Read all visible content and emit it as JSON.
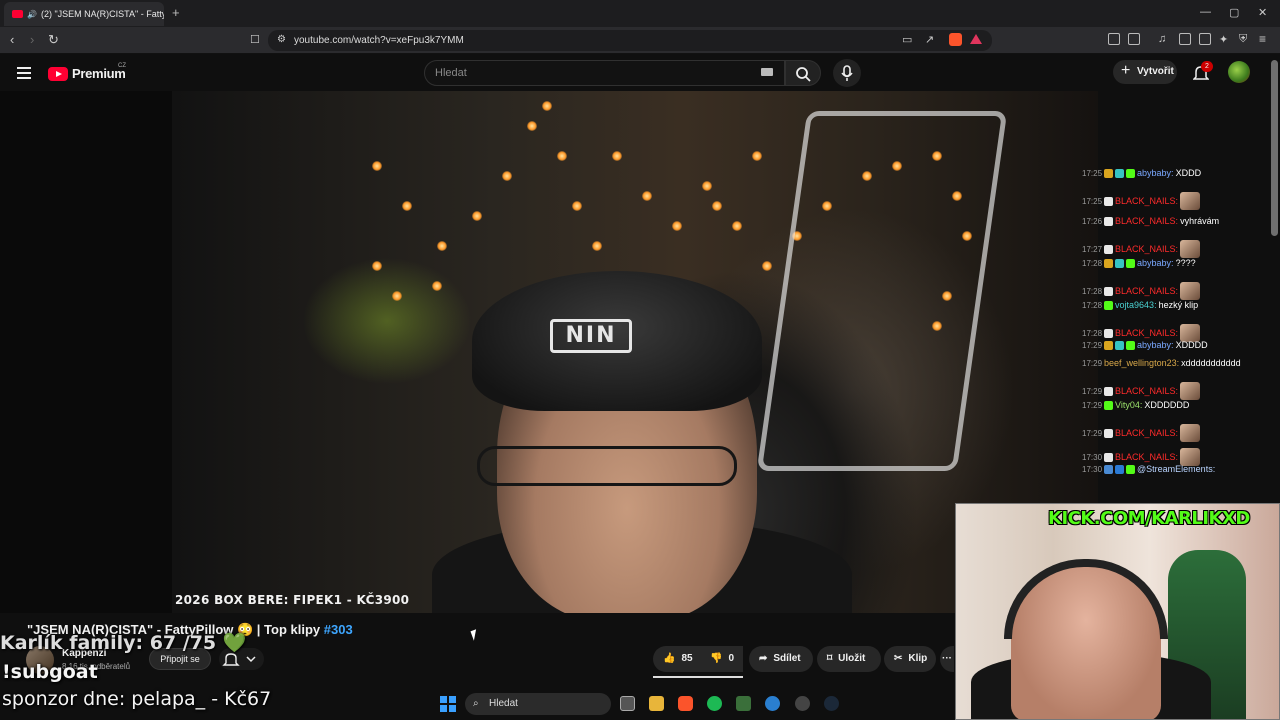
{
  "browser": {
    "tab_title": "(2) \"JSEM NA(R)CISTA\" - Fatty",
    "tab_close": "✕",
    "new_tab": "+",
    "url": "youtube.com/watch?v=xeFpu3k7YMM",
    "window_controls": [
      "—",
      "▢",
      "✕"
    ]
  },
  "youtube_header": {
    "logo_text": "Premium",
    "logo_region": "CZ",
    "search_placeholder": "Hledat",
    "create_label": "Vytvořit",
    "notification_count": "2"
  },
  "video": {
    "cap_logo": "NIN",
    "overlay_subtitle": "2026 BOX BERE: FIPEK1 - KČ3900",
    "kick_banner": "KICK.COM/KARLIKXD"
  },
  "chat": {
    "messages": [
      {
        "time": "17:25",
        "user": "abybaby:",
        "text": "XDDD",
        "color": "#7aa8ff",
        "badges": [
          "#d9a51f",
          "#37c3c3",
          "#53fc18"
        ],
        "emote": false
      },
      {
        "time": "17:25",
        "user": "BLACK_NAILS:",
        "text": "",
        "color": "#ff2b2b",
        "badges": [
          "#e8e8e8"
        ],
        "emote": true
      },
      {
        "time": "17:26",
        "user": "BLACK_NAILS:",
        "text": "vyhrávám",
        "color": "#ff2b2b",
        "badges": [
          "#e8e8e8"
        ],
        "emote": false
      },
      {
        "time": "17:27",
        "user": "BLACK_NAILS:",
        "text": "",
        "color": "#ff2b2b",
        "badges": [
          "#e8e8e8"
        ],
        "emote": true
      },
      {
        "time": "17:28",
        "user": "abybaby:",
        "text": "????",
        "color": "#7aa8ff",
        "badges": [
          "#d9a51f",
          "#37c3c3",
          "#53fc18"
        ],
        "emote": false
      },
      {
        "time": "17:28",
        "user": "BLACK_NAILS:",
        "text": "",
        "color": "#ff2b2b",
        "badges": [
          "#e8e8e8"
        ],
        "emote": true
      },
      {
        "time": "17:28",
        "user": "vojta9643:",
        "text": "hezký klip",
        "color": "#4ad0d0",
        "badges": [
          "#53fc18"
        ],
        "emote": false
      },
      {
        "time": "17:28",
        "user": "BLACK_NAILS:",
        "text": "",
        "color": "#ff2b2b",
        "badges": [
          "#e8e8e8"
        ],
        "emote": true
      },
      {
        "time": "17:29",
        "user": "abybaby:",
        "text": "XDDDD",
        "color": "#7aa8ff",
        "badges": [
          "#d9a51f",
          "#37c3c3",
          "#53fc18"
        ],
        "emote": false
      },
      {
        "time": "17:29",
        "user": "beef_wellington23:",
        "text": "xddddddddddd",
        "color": "#d8a84a",
        "badges": [],
        "emote": false
      },
      {
        "time": "17:29",
        "user": "BLACK_NAILS:",
        "text": "",
        "color": "#ff2b2b",
        "badges": [
          "#e8e8e8"
        ],
        "emote": true
      },
      {
        "time": "17:29",
        "user": "Vity04:",
        "text": "XDDDDDD",
        "color": "#9be36b",
        "badges": [
          "#53fc18"
        ],
        "emote": false
      },
      {
        "time": "17:29",
        "user": "BLACK_NAILS:",
        "text": "",
        "color": "#ff2b2b",
        "badges": [
          "#e8e8e8"
        ],
        "emote": true
      },
      {
        "time": "17:30",
        "user": "BLACK_NAILS:",
        "text": "",
        "color": "#ff2b2b",
        "badges": [
          "#e8e8e8"
        ],
        "emote": true
      },
      {
        "time": "17:30",
        "user": "@StreamElements:",
        "text": "",
        "color": "#b9d4ff",
        "badges": [
          "#4a8bd4",
          "#2b7bd6",
          "#53fc18"
        ],
        "emote": false
      }
    ]
  },
  "video_info": {
    "title": "\"JSEM NA(R)CISTA\" - FattyPillow 😳 | Top klipy",
    "hashtag": "#303",
    "channel_name": "Kappenzi",
    "subscribers": "8,16 tis. odběratelů",
    "join_label": "Připojit se",
    "like_count": "85",
    "dislike_count": "0",
    "share_label": "Sdílet",
    "save_label": "Uložit",
    "clip_label": "Klip",
    "more_label": "···"
  },
  "stream_overlay": {
    "line1": "Karlík family: 67 /75 💚",
    "line2": "!subgoat",
    "line3": "sponzor dne: pelapa_ - Kč67"
  },
  "taskbar": {
    "search_label": "Hledat"
  }
}
